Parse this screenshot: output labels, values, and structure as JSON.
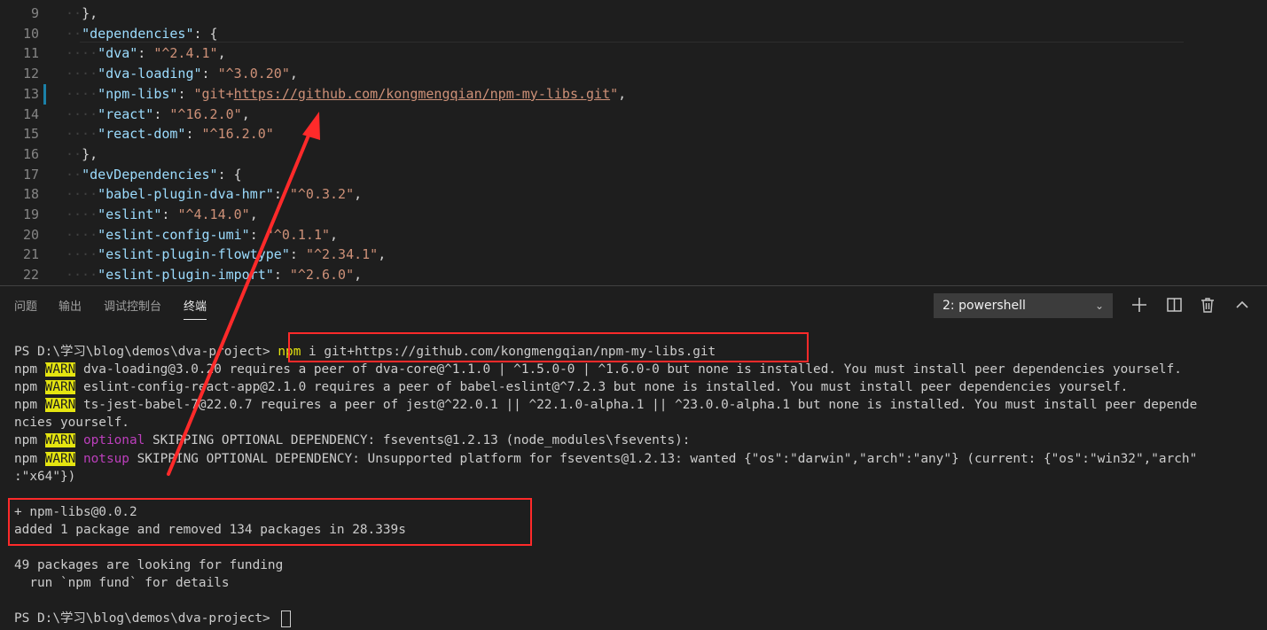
{
  "editor": {
    "lines": [
      {
        "n": "9",
        "ind": "··",
        "parts": [
          [
            "pun",
            "},"
          ]
        ]
      },
      {
        "n": "10",
        "ind": "··",
        "parts": [
          [
            "key",
            "\"dependencies\""
          ],
          [
            "pun",
            ": {"
          ]
        ]
      },
      {
        "n": "11",
        "ind": "····",
        "parts": [
          [
            "key",
            "\"dva\""
          ],
          [
            "pun",
            ": "
          ],
          [
            "str",
            "\"^2.4.1\""
          ],
          [
            "pun",
            ","
          ]
        ]
      },
      {
        "n": "12",
        "ind": "····",
        "parts": [
          [
            "key",
            "\"dva-loading\""
          ],
          [
            "pun",
            ": "
          ],
          [
            "str",
            "\"^3.0.20\""
          ],
          [
            "pun",
            ","
          ]
        ]
      },
      {
        "n": "13",
        "ind": "····",
        "parts": [
          [
            "key",
            "\"npm-libs\""
          ],
          [
            "pun",
            ": "
          ],
          [
            "str",
            "\"git+"
          ],
          [
            "strurl",
            "https://github.com/kongmengqian/npm-my-libs.git"
          ],
          [
            "str",
            "\""
          ],
          [
            "pun",
            ","
          ]
        ]
      },
      {
        "n": "14",
        "ind": "····",
        "parts": [
          [
            "key",
            "\"react\""
          ],
          [
            "pun",
            ": "
          ],
          [
            "str",
            "\"^16.2.0\""
          ],
          [
            "pun",
            ","
          ]
        ]
      },
      {
        "n": "15",
        "ind": "····",
        "parts": [
          [
            "key",
            "\"react-dom\""
          ],
          [
            "pun",
            ": "
          ],
          [
            "str",
            "\"^16.2.0\""
          ]
        ]
      },
      {
        "n": "16",
        "ind": "··",
        "parts": [
          [
            "pun",
            "},"
          ]
        ]
      },
      {
        "n": "17",
        "ind": "··",
        "parts": [
          [
            "key",
            "\"devDependencies\""
          ],
          [
            "pun",
            ": {"
          ]
        ]
      },
      {
        "n": "18",
        "ind": "····",
        "parts": [
          [
            "key",
            "\"babel-plugin-dva-hmr\""
          ],
          [
            "pun",
            ": "
          ],
          [
            "str",
            "\"^0.3.2\""
          ],
          [
            "pun",
            ","
          ]
        ]
      },
      {
        "n": "19",
        "ind": "····",
        "parts": [
          [
            "key",
            "\"eslint\""
          ],
          [
            "pun",
            ": "
          ],
          [
            "str",
            "\"^4.14.0\""
          ],
          [
            "pun",
            ","
          ]
        ]
      },
      {
        "n": "20",
        "ind": "····",
        "parts": [
          [
            "key",
            "\"eslint-config-umi\""
          ],
          [
            "pun",
            ": "
          ],
          [
            "str",
            "\"^0.1.1\""
          ],
          [
            "pun",
            ","
          ]
        ]
      },
      {
        "n": "21",
        "ind": "····",
        "parts": [
          [
            "key",
            "\"eslint-plugin-flowtype\""
          ],
          [
            "pun",
            ": "
          ],
          [
            "str",
            "\"^2.34.1\""
          ],
          [
            "pun",
            ","
          ]
        ]
      },
      {
        "n": "22",
        "ind": "····",
        "parts": [
          [
            "key",
            "\"eslint-plugin-import\""
          ],
          [
            "pun",
            ": "
          ],
          [
            "str",
            "\"^2.6.0\""
          ],
          [
            "pun",
            ","
          ]
        ]
      }
    ]
  },
  "panel": {
    "tabs": [
      "问题",
      "输出",
      "调试控制台",
      "终端"
    ],
    "active_tab": "终端",
    "terminal_select": "2: powershell",
    "icons": [
      "plus-icon",
      "split-icon",
      "trash-icon",
      "chevron-up-icon"
    ]
  },
  "terminal": {
    "lines": [
      [
        [
          "plain",
          "PS D:\\学习\\blog\\demos\\dva-project> "
        ],
        [
          "yel",
          "npm"
        ],
        [
          "plain",
          " i git+https://github.com/kongmengqian/npm-my-libs.git"
        ]
      ],
      [
        [
          "plain",
          "npm "
        ],
        [
          "warn",
          "WARN"
        ],
        [
          "plain",
          " dva-loading@3.0.20 requires a peer of dva-core@^1.1.0 | ^1.5.0-0 | ^1.6.0-0 but none is installed. You must install peer dependencies yourself."
        ]
      ],
      [
        [
          "plain",
          "npm "
        ],
        [
          "warn",
          "WARN"
        ],
        [
          "plain",
          " eslint-config-react-app@2.1.0 requires a peer of babel-eslint@^7.2.3 but none is installed. You must install peer dependencies yourself."
        ]
      ],
      [
        [
          "plain",
          "npm "
        ],
        [
          "warn",
          "WARN"
        ],
        [
          "plain",
          " ts-jest-babel-7@22.0.7 requires a peer of jest@^22.0.1 || ^22.1.0-alpha.1 || ^23.0.0-alpha.1 but none is installed. You must install peer depende"
        ]
      ],
      [
        [
          "plain",
          "ncies yourself."
        ]
      ],
      [
        [
          "plain",
          "npm "
        ],
        [
          "warn",
          "WARN"
        ],
        [
          "plain",
          " "
        ],
        [
          "mag",
          "optional"
        ],
        [
          "plain",
          " SKIPPING OPTIONAL DEPENDENCY: fsevents@1.2.13 (node_modules\\fsevents):"
        ]
      ],
      [
        [
          "plain",
          "npm "
        ],
        [
          "warn",
          "WARN"
        ],
        [
          "plain",
          " "
        ],
        [
          "mag",
          "notsup"
        ],
        [
          "plain",
          " SKIPPING OPTIONAL DEPENDENCY: Unsupported platform for fsevents@1.2.13: wanted {\"os\":\"darwin\",\"arch\":\"any\"} (current: {\"os\":\"win32\",\"arch\""
        ]
      ],
      [
        [
          "plain",
          ":\"x64\"})"
        ]
      ],
      [
        [
          "plain",
          ""
        ]
      ],
      [
        [
          "plain",
          "+ npm-libs@0.0.2"
        ]
      ],
      [
        [
          "plain",
          "added 1 package and removed 134 packages in 28.339s"
        ]
      ],
      [
        [
          "plain",
          ""
        ]
      ],
      [
        [
          "plain",
          "49 packages are looking for funding"
        ]
      ],
      [
        [
          "plain",
          "  run `npm fund` for details"
        ]
      ],
      [
        [
          "plain",
          ""
        ]
      ],
      [
        [
          "plain",
          "PS D:\\学习\\blog\\demos\\dva-project> "
        ],
        [
          "cursor",
          ""
        ]
      ]
    ]
  },
  "colors": {
    "background": "#1e1e1e",
    "annotation": "#ff2a2a",
    "warn_bg": "#e5e510",
    "json_key": "#9cdcfe",
    "json_string": "#ce9178"
  }
}
